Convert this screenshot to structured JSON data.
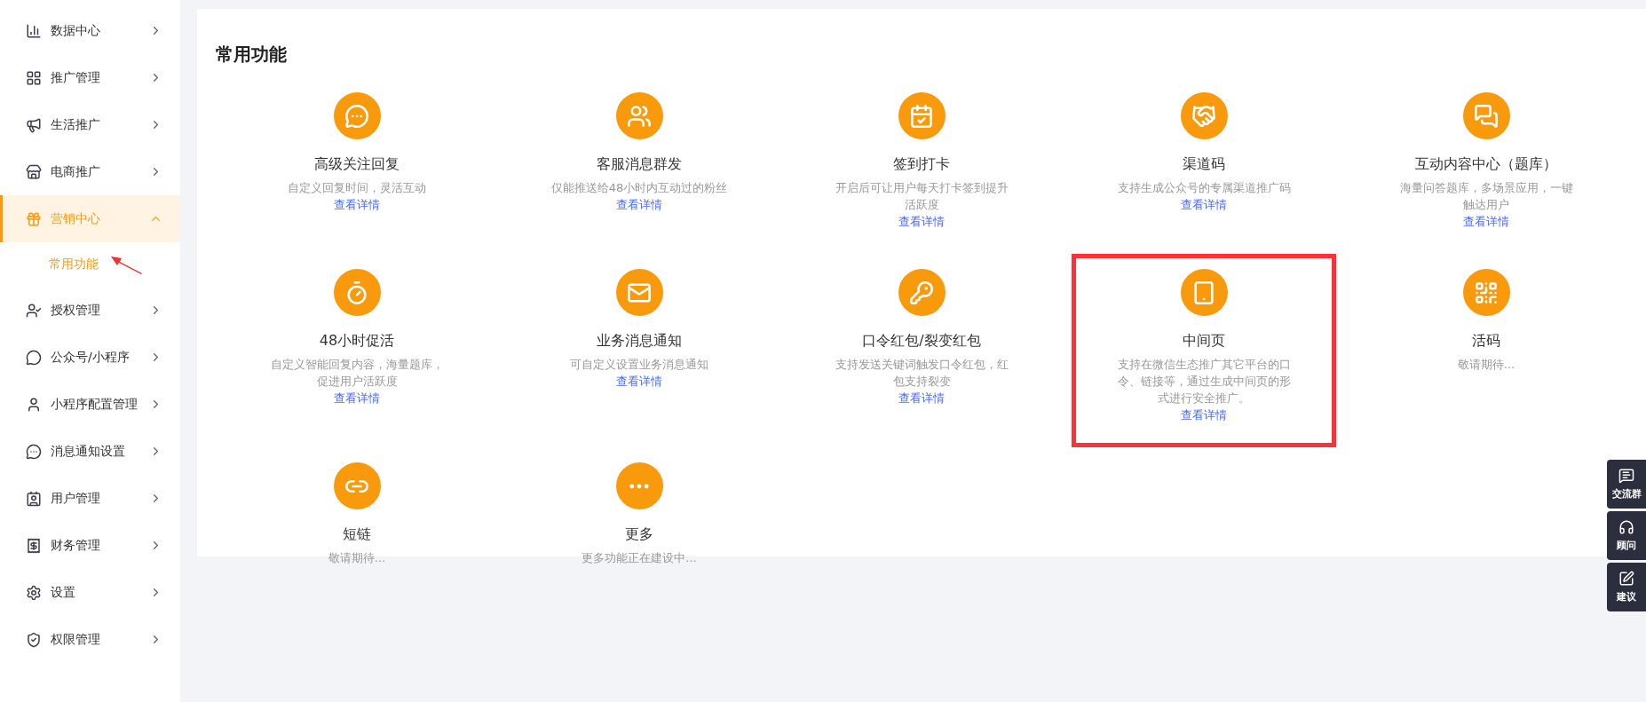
{
  "sidebar": {
    "items": [
      {
        "label": "数据中心",
        "selected": false,
        "expanded": false
      },
      {
        "label": "推广管理",
        "selected": false,
        "expanded": false
      },
      {
        "label": "生活推广",
        "selected": false,
        "expanded": false
      },
      {
        "label": "电商推广",
        "selected": false,
        "expanded": false
      },
      {
        "label": "营销中心",
        "selected": true,
        "expanded": true,
        "children": [
          {
            "label": "常用功能",
            "selected": true
          }
        ]
      },
      {
        "label": "授权管理",
        "selected": false,
        "expanded": false
      },
      {
        "label": "公众号/小程序",
        "selected": false,
        "expanded": false
      },
      {
        "label": "小程序配置管理",
        "selected": false,
        "expanded": false
      },
      {
        "label": "消息通知设置",
        "selected": false,
        "expanded": false
      },
      {
        "label": "用户管理",
        "selected": false,
        "expanded": false
      },
      {
        "label": "财务管理",
        "selected": false,
        "expanded": false
      },
      {
        "label": "设置",
        "selected": false,
        "expanded": false
      },
      {
        "label": "权限管理",
        "selected": false,
        "expanded": false
      }
    ]
  },
  "main": {
    "title": "常用功能",
    "features": [
      {
        "title": "高级关注回复",
        "description": "自定义回复时间，灵活互动",
        "link": "查看详情",
        "highlighted": false
      },
      {
        "title": "客服消息群发",
        "description": "仅能推送给48小时内互动过的粉丝",
        "link": "查看详情",
        "highlighted": false
      },
      {
        "title": "签到打卡",
        "description": "开启后可让用户每天打卡签到提升活跃度",
        "link": "查看详情",
        "highlighted": false
      },
      {
        "title": "渠道码",
        "description": "支持生成公众号的专属渠道推广码",
        "link": "查看详情",
        "highlighted": false
      },
      {
        "title": "互动内容中心（题库）",
        "description": "海量问答题库，多场景应用，一键触达用户",
        "link": "查看详情",
        "highlighted": false
      },
      {
        "title": "48小时促活",
        "description": "自定义智能回复内容，海量题库，促进用户活跃度",
        "link": "查看详情",
        "highlighted": false
      },
      {
        "title": "业务消息通知",
        "description": "可自定义设置业务消息通知",
        "link": "查看详情",
        "highlighted": false
      },
      {
        "title": "口令红包/裂变红包",
        "description": "支持发送关键词触发口令红包，红包支持裂变",
        "link": "查看详情",
        "highlighted": false
      },
      {
        "title": "中间页",
        "description": "支持在微信生态推广其它平台的口令、链接等，通过生成中间页的形式进行安全推广。",
        "link": "查看详情",
        "highlighted": true
      },
      {
        "title": "活码",
        "description": "敬请期待...",
        "highlighted": false
      },
      {
        "title": "短链",
        "description": "敬请期待...",
        "highlighted": false
      },
      {
        "title": "更多",
        "description": "更多功能正在建设中...",
        "highlighted": false
      }
    ]
  },
  "floating_tools": [
    {
      "label": "交流群"
    },
    {
      "label": "顾问"
    },
    {
      "label": "建议"
    }
  ]
}
